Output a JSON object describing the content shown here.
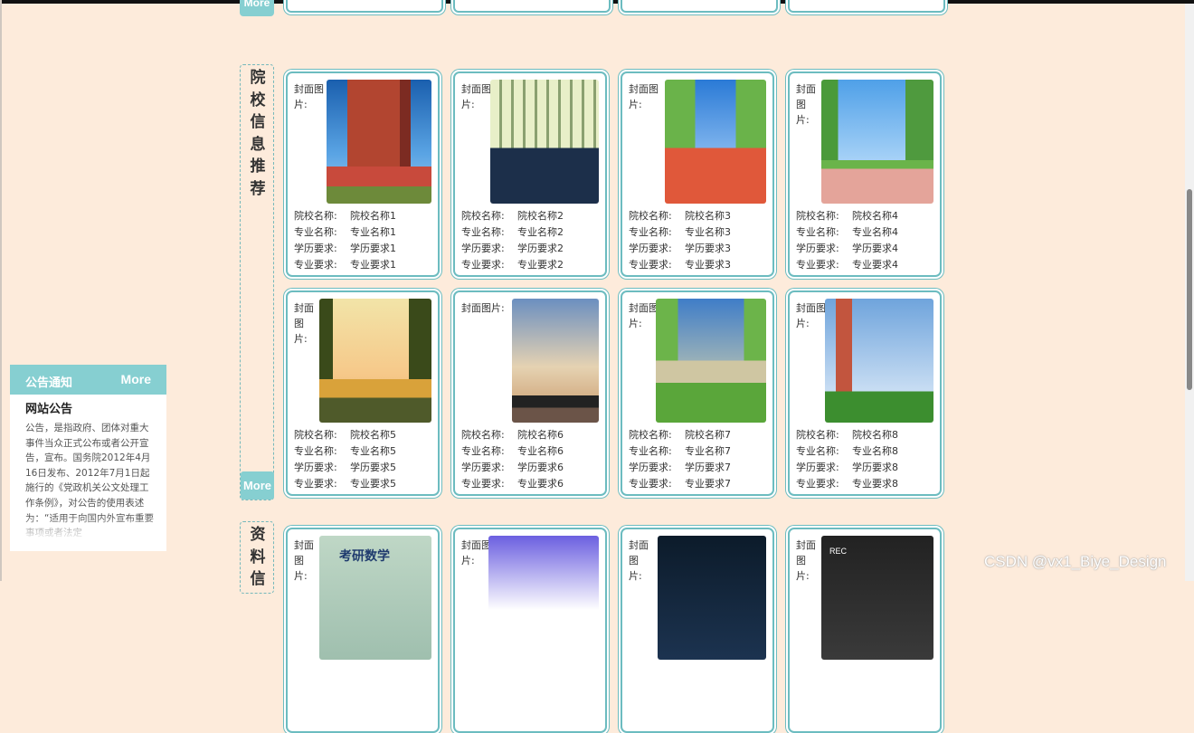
{
  "previous_section": {
    "more_label": "More"
  },
  "section_college": {
    "title_chars": [
      "院",
      "校",
      "信",
      "息",
      "推",
      "荐"
    ],
    "more_label": "More",
    "cards": [
      {
        "cover_label": "封面图片:",
        "school_name": "院校名称1",
        "major_name": "专业名称1",
        "education_req": "学历要求1",
        "major_req": "专业要求1",
        "image": "campus-building-photo"
      },
      {
        "cover_label": "封面图片:",
        "school_name": "院校名称2",
        "major_name": "专业名称2",
        "education_req": "学历要求2",
        "major_req": "专业要求2",
        "image": "classroom-photo"
      },
      {
        "cover_label": "封面图片:",
        "school_name": "院校名称3",
        "major_name": "专业名称3",
        "education_req": "学历要求3",
        "major_req": "专业要求3",
        "image": "campus-stairs-illustration"
      },
      {
        "cover_label": "封面图片:",
        "school_name": "院校名称4",
        "major_name": "专业名称4",
        "education_req": "学历要求4",
        "major_req": "专业要求4",
        "image": "running-track-illustration"
      },
      {
        "cover_label": "封面图片:",
        "school_name": "院校名称5",
        "major_name": "专业名称5",
        "education_req": "学历要求5",
        "major_req": "专业要求5",
        "image": "tree-sunset-photo"
      },
      {
        "cover_label": "封面图片:",
        "school_name": "院校名称6",
        "major_name": "专业名称6",
        "education_req": "学历要求6",
        "major_req": "专业要求6",
        "image": "sky-playground-photo"
      },
      {
        "cover_label": "封面图片:",
        "school_name": "院校名称7",
        "major_name": "专业名称7",
        "education_req": "学历要求7",
        "major_req": "专业要求7",
        "image": "school-building-illustration"
      },
      {
        "cover_label": "封面图片:",
        "school_name": "院校名称8",
        "major_name": "专业名称8",
        "education_req": "学历要求8",
        "major_req": "专业要求8",
        "image": "clock-tower-illustration"
      }
    ],
    "field_labels": {
      "school_name": "院校名称:",
      "major_name": "专业名称:",
      "education_req": "学历要求:",
      "major_req": "专业要求:"
    }
  },
  "section_materials": {
    "title_chars": [
      "资",
      "料",
      "信"
    ],
    "cards": [
      {
        "cover_label": "封面图片:",
        "image": "kaoyan-math-cover",
        "image_text": "考研数学"
      },
      {
        "cover_label": "封面图片:",
        "image": "anime-character-cover"
      },
      {
        "cover_label": "封面图片:",
        "image": "dark-calligraphy-cover"
      },
      {
        "cover_label": "封面图片:",
        "image": "recording-frame-cover",
        "image_text": "REC"
      }
    ]
  },
  "notice": {
    "header_title": "公告通知",
    "more_label": "More",
    "name": "网站公告",
    "body": "公告，是指政府、团体对重大事件当众正式公布或者公开宣告，宣布。国务院2012年4月16日发布、2012年7月1日起施行的《党政机关公文处理工作条例》，对公告的使用表述为：“适用于向国内外宣布重要事项或者法定"
  },
  "watermark": "CSDN @vx1_Biye_Design"
}
